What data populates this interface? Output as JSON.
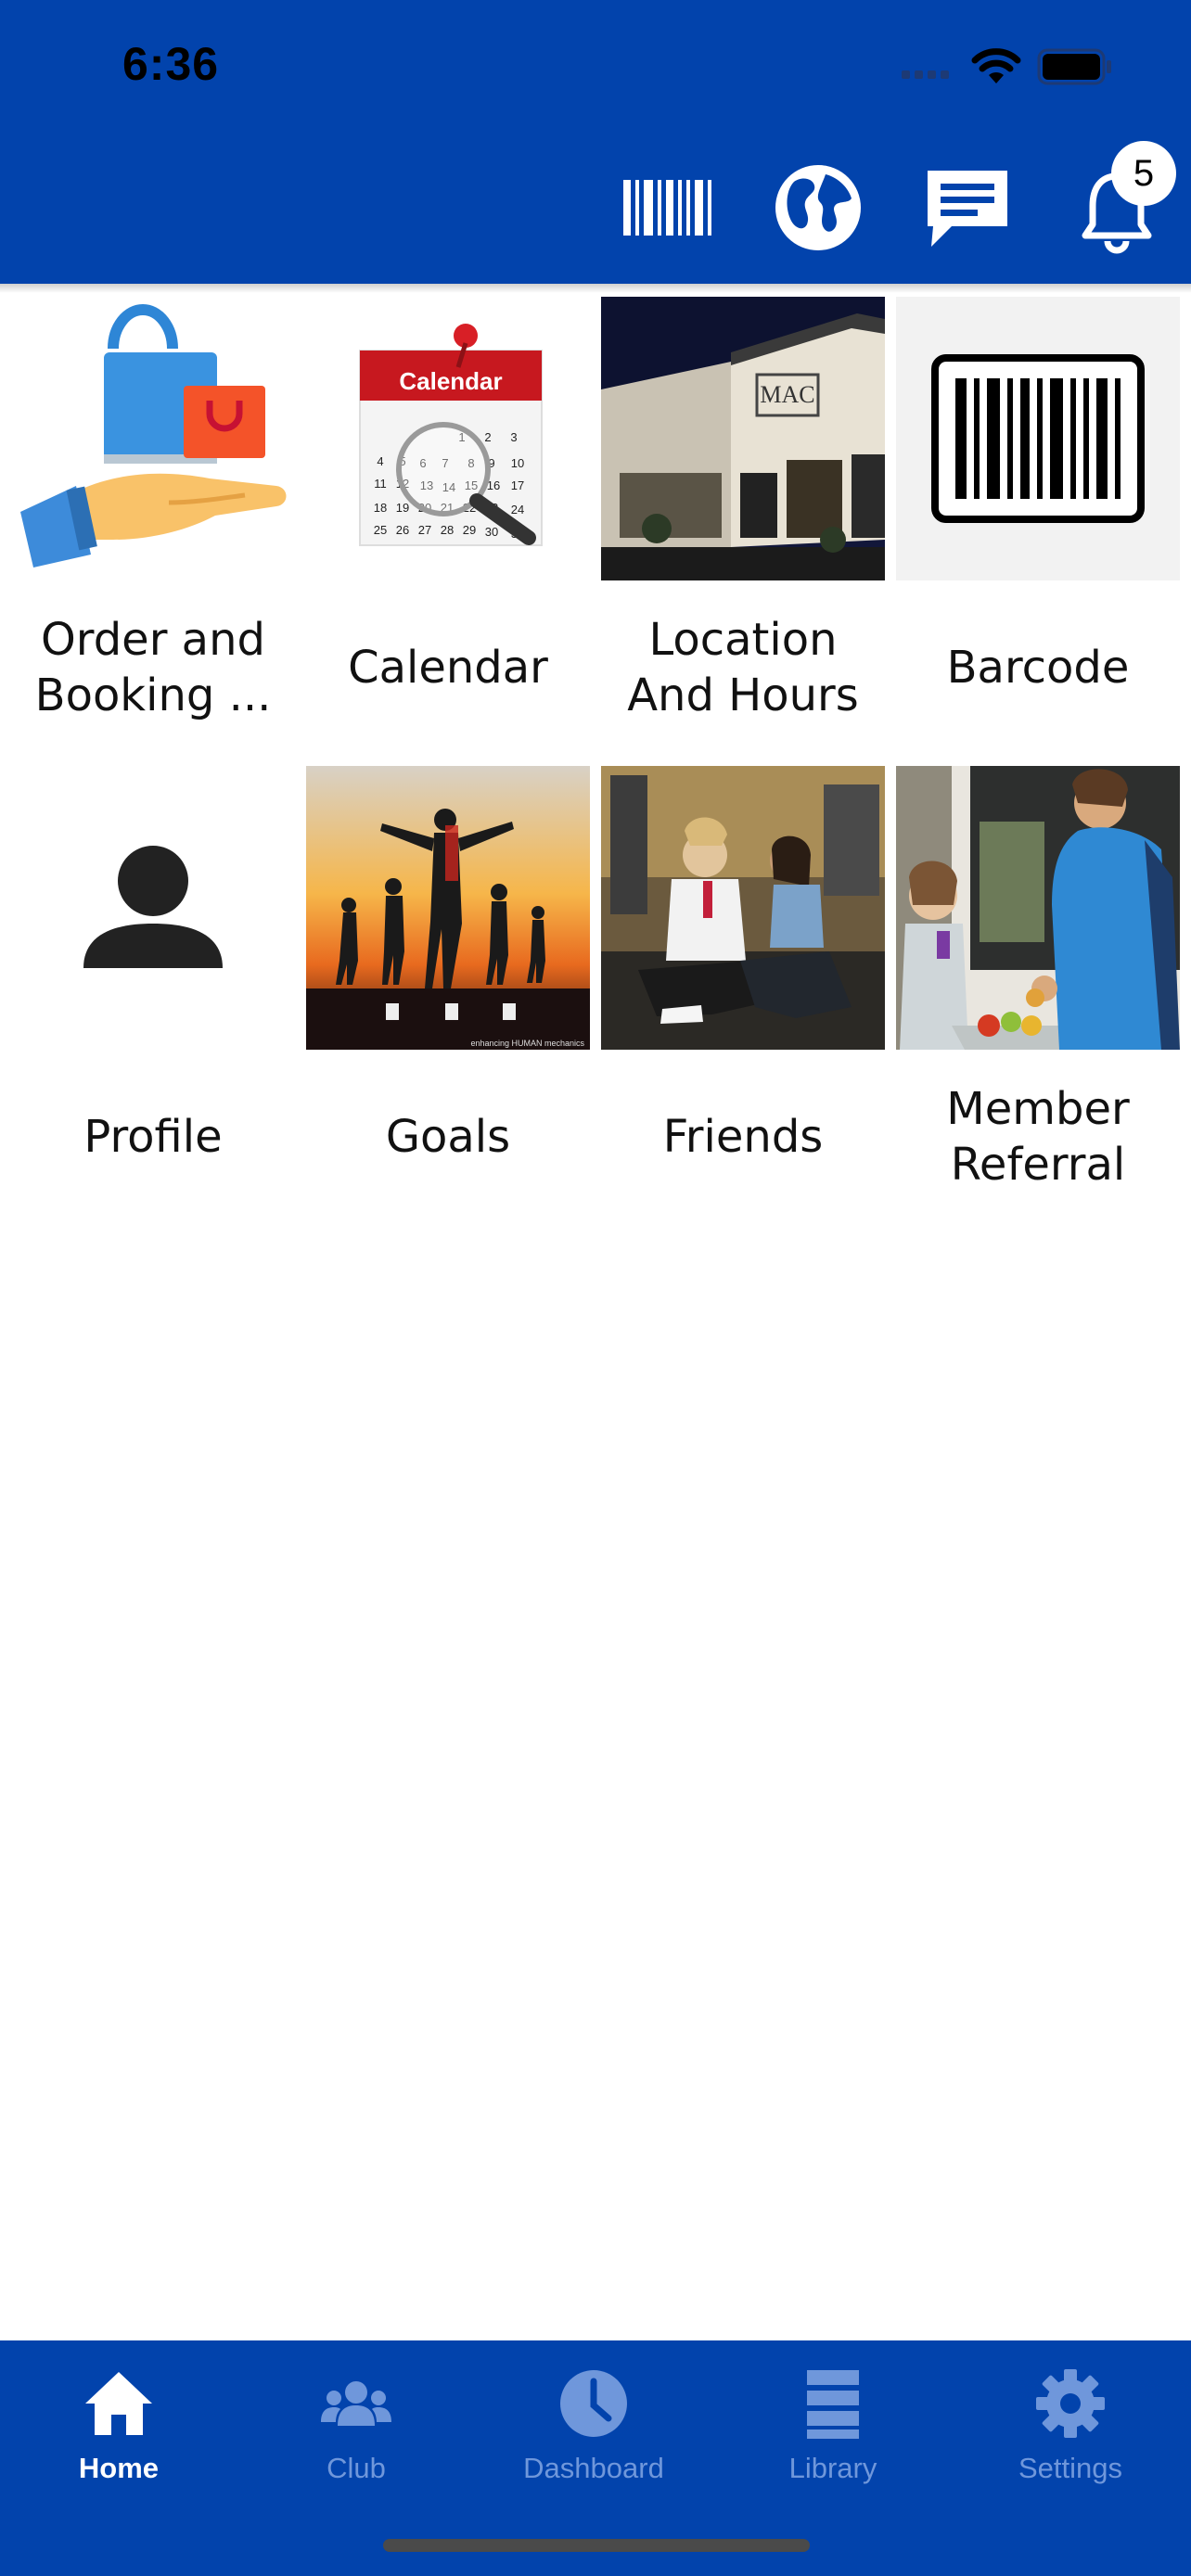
{
  "status_bar": {
    "time": "6:36"
  },
  "header": {
    "icons": [
      "barcode-icon",
      "globe-icon",
      "message-icon",
      "bell-icon"
    ],
    "notification_count": "5",
    "background_color": "#0243AC"
  },
  "tiles": [
    {
      "label": "Order and Booking ...",
      "image": "shopping-bag-hand-icon"
    },
    {
      "label": "Calendar",
      "image": "calendar-magnifier-icon"
    },
    {
      "label": "Location And Hours",
      "image": "club-building-photo"
    },
    {
      "label": "Barcode",
      "image": "barcode-icon"
    },
    {
      "label": "Profile",
      "image": "person-icon"
    },
    {
      "label": "Goals",
      "image": "runners-sunset-photo"
    },
    {
      "label": "Friends",
      "image": "gym-friends-photo"
    },
    {
      "label": "Member Referral",
      "image": "kitchen-referral-photo"
    }
  ],
  "goals_image_caption": "enhancing HUMAN mechanics",
  "calendar_image_title": "Calendar",
  "tabbar": {
    "items": [
      {
        "label": "Home",
        "icon": "home-icon",
        "active": true
      },
      {
        "label": "Club",
        "icon": "group-icon",
        "active": false
      },
      {
        "label": "Dashboard",
        "icon": "clock-icon",
        "active": false
      },
      {
        "label": "Library",
        "icon": "library-icon",
        "active": false
      },
      {
        "label": "Settings",
        "icon": "gear-icon",
        "active": false
      }
    ]
  }
}
